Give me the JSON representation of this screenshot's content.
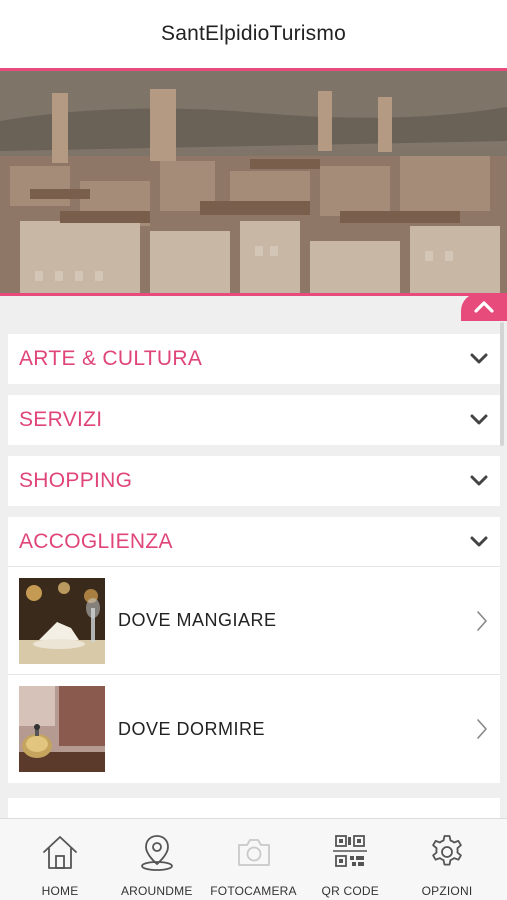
{
  "header": {
    "title": "SantElpidioTurismo"
  },
  "colors": {
    "accent": "#e64b7b",
    "category_text": "#e0457a"
  },
  "hero": {
    "image": "aerial-town-photo"
  },
  "collapse_icon": "chevron-up-icon",
  "categories": [
    {
      "label": "ARTE & CULTURA",
      "icon": "chevron-down-icon",
      "expanded": false
    },
    {
      "label": "SERVIZI",
      "icon": "chevron-down-icon",
      "expanded": false
    },
    {
      "label": "SHOPPING",
      "icon": "chevron-down-icon",
      "expanded": false
    },
    {
      "label": "ACCOGLIENZA",
      "icon": "chevron-down-icon",
      "expanded": true,
      "items": [
        {
          "label": "DOVE MANGIARE",
          "thumb": "restaurant-table-photo",
          "icon": "chevron-right-icon"
        },
        {
          "label": "DOVE DORMIRE",
          "thumb": "hotel-bell-photo",
          "icon": "chevron-right-icon"
        }
      ]
    }
  ],
  "tabbar": {
    "items": [
      {
        "label": "HOME",
        "icon": "home-icon"
      },
      {
        "label": "AROUNDME",
        "icon": "location-pin-icon"
      },
      {
        "label": "FOTOCAMERA",
        "icon": "camera-icon"
      },
      {
        "label": "QR CODE",
        "icon": "qr-code-icon"
      },
      {
        "label": "OPZIONI",
        "icon": "gear-icon"
      }
    ]
  }
}
